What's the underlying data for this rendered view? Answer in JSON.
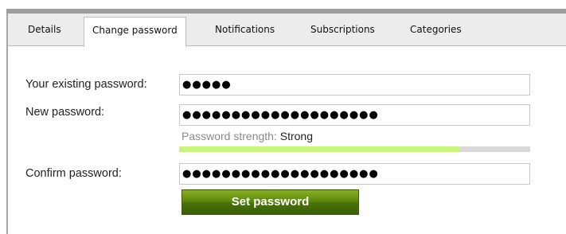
{
  "tabs": [
    {
      "label": "Details"
    },
    {
      "label": "Change password",
      "active": true
    },
    {
      "label": "Notifications"
    },
    {
      "label": "Subscriptions"
    },
    {
      "label": "Categories"
    }
  ],
  "form": {
    "existing_password_label": "Your existing password:",
    "existing_password_value": "●●●●●",
    "new_password_label": "New password:",
    "new_password_value": "●●●●●●●●●●●●●●●●●●●●",
    "strength_label": "Password strength:",
    "strength_value": "Strong",
    "strength_fraction": 0.8,
    "confirm_password_label": "Confirm password:",
    "confirm_password_value": "●●●●●●●●●●●●●●●●●●●●",
    "submit_label": "Set password"
  },
  "colors": {
    "meter_fill": "#c8f57c",
    "meter_track": "#d9d9d9",
    "button_green": "#5d8a0c"
  }
}
